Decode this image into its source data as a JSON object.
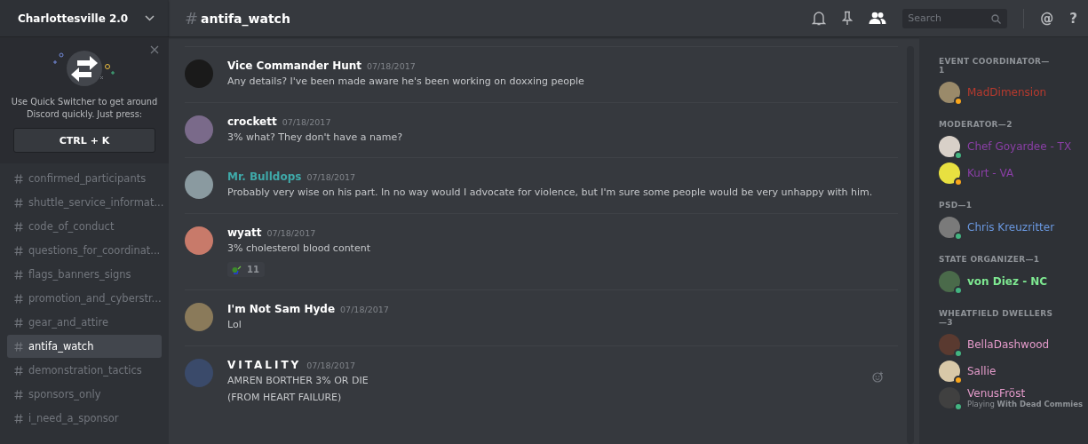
{
  "server": {
    "name": "Charlottesville 2.0"
  },
  "quick_switcher": {
    "text": "Use Quick Switcher to get around Discord quickly. Just press:",
    "shortcut": "CTRL + K"
  },
  "channels": [
    {
      "name": "confirmed_participants",
      "selected": false
    },
    {
      "name": "shuttle_service_informat...",
      "selected": false
    },
    {
      "name": "code_of_conduct",
      "selected": false
    },
    {
      "name": "questions_for_coordinat...",
      "selected": false
    },
    {
      "name": "flags_banners_signs",
      "selected": false
    },
    {
      "name": "promotion_and_cyberstr...",
      "selected": false
    },
    {
      "name": "gear_and_attire",
      "selected": false
    },
    {
      "name": "antifa_watch",
      "selected": true
    },
    {
      "name": "demonstration_tactics",
      "selected": false
    },
    {
      "name": "sponsors_only",
      "selected": false
    },
    {
      "name": "i_need_a_sponsor",
      "selected": false
    }
  ],
  "header": {
    "hash": "#",
    "channel": "antifa_watch",
    "search": {
      "placeholder": "Search"
    },
    "at": "@",
    "help": "?"
  },
  "messages": [
    {
      "author": "Vice Commander Hunt",
      "color": "#ffffff",
      "time": "07/18/2017",
      "lines": [
        "Any details? I've been made aware he's been working on doxxing people"
      ]
    },
    {
      "author": "crockett",
      "color": "#ffffff",
      "time": "07/18/2017",
      "lines": [
        "3% what? They don't have a name?"
      ]
    },
    {
      "author": "Mr. Bulldops",
      "color": "#3fa9a9",
      "time": "07/18/2017",
      "lines": [
        "Probably very wise on his part. In no way would I advocate for violence, but I'm sure some people would be very unhappy with him."
      ]
    },
    {
      "author": "wyatt",
      "color": "#ffffff",
      "time": "07/18/2017",
      "lines": [
        "3% cholesterol blood content"
      ],
      "reaction": {
        "count": "11"
      }
    },
    {
      "author": "I'm Not Sam Hyde",
      "color": "#ffffff",
      "time": "07/18/2017",
      "lines": [
        "Lol"
      ]
    },
    {
      "author": "VITALITY",
      "color": "#ffffff",
      "wide": true,
      "time": "07/18/2017",
      "lines": [
        "AMREN BORTHER 3% OR DIE",
        "(FROM HEART FAILURE)"
      ],
      "hovered": true
    }
  ],
  "members": [
    {
      "role": "EVENT COORDINATOR—1",
      "people": [
        {
          "name": "MadDimension",
          "color": "#b83a2e",
          "status": {
            "color": "#faa61a"
          }
        }
      ]
    },
    {
      "role": "MODERATOR—2",
      "people": [
        {
          "name": "Chef Goyardee - TX",
          "color": "#8a3fa6",
          "status": {
            "color": "#43b581"
          }
        },
        {
          "name": "Kurt - VA",
          "color": "#8a3fa6",
          "status": {
            "color": "#faa61a"
          }
        }
      ]
    },
    {
      "role": "PSD—1",
      "people": [
        {
          "name": "Chris Kreuzritter",
          "color": "#6a98e0",
          "status": {
            "color": "#43b581"
          }
        }
      ]
    },
    {
      "role": "STATE ORGANIZER—1",
      "people": [
        {
          "name": "von Diez - NC",
          "color": "#7ee891",
          "status": {
            "color": "#43b581"
          },
          "bold": true
        }
      ]
    },
    {
      "role": "WHEATFIELD DWELLERS—3",
      "people": [
        {
          "name": "BellaDashwood",
          "color": "#e59bcb",
          "status": {
            "color": "#43b581"
          }
        },
        {
          "name": "Sallie",
          "color": "#e59bcb",
          "status": {
            "color": "#faa61a"
          }
        },
        {
          "name": "VenusFröst",
          "color": "#e59bcb",
          "status": {
            "color": "#43b581"
          },
          "activity": "Playing **With Dead Commies**"
        }
      ]
    }
  ]
}
